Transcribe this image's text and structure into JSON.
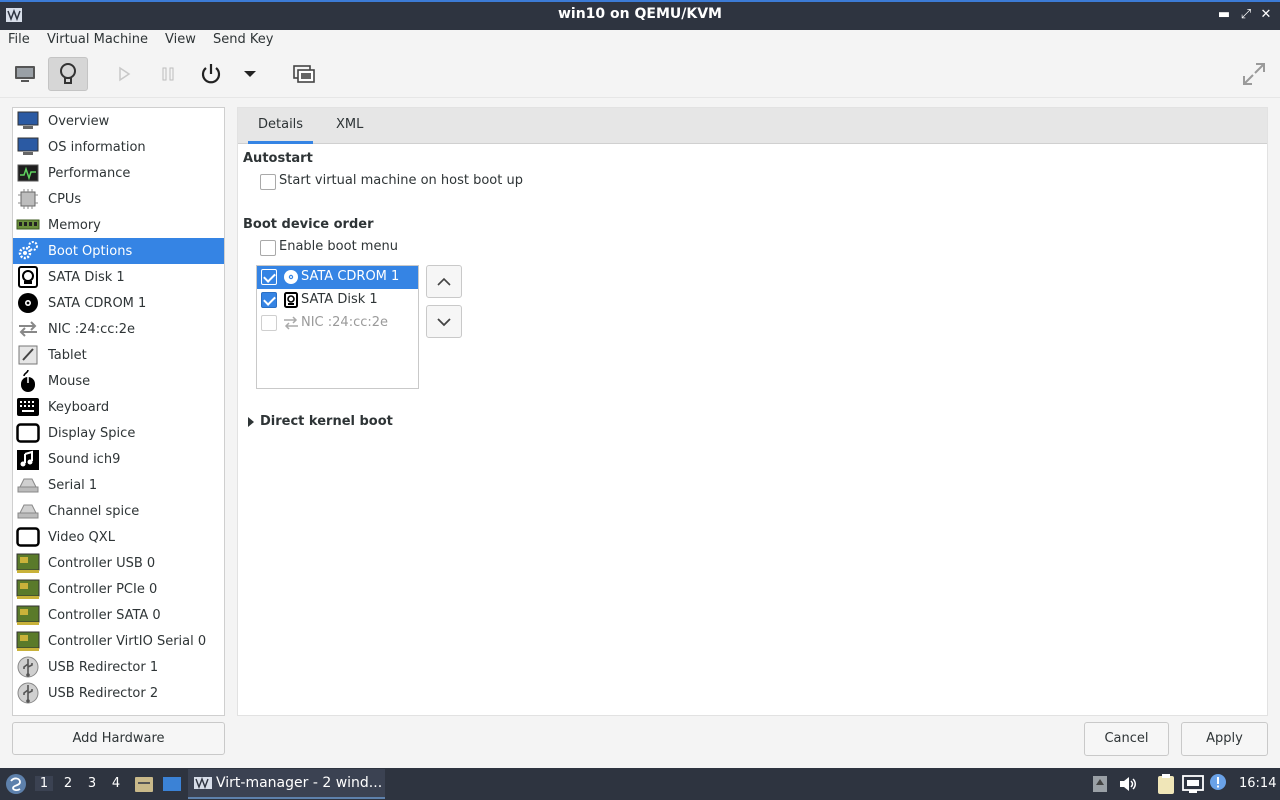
{
  "window": {
    "title": "win10 on QEMU/KVM"
  },
  "menubar": {
    "items": [
      "File",
      "Virtual Machine",
      "View",
      "Send Key"
    ]
  },
  "sidebar": {
    "items": [
      {
        "label": "Overview",
        "icon": "monitor-icon"
      },
      {
        "label": "OS information",
        "icon": "monitor-icon"
      },
      {
        "label": "Performance",
        "icon": "performance-chart-icon"
      },
      {
        "label": "CPUs",
        "icon": "cpu-chip-icon"
      },
      {
        "label": "Memory",
        "icon": "memory-module-icon"
      },
      {
        "label": "Boot Options",
        "icon": "gears-icon",
        "selected": true
      },
      {
        "label": "SATA Disk 1",
        "icon": "hard-disk-icon"
      },
      {
        "label": "SATA CDROM 1",
        "icon": "cdrom-icon"
      },
      {
        "label": "NIC :24:cc:2e",
        "icon": "network-arrows-icon"
      },
      {
        "label": "Tablet",
        "icon": "tablet-icon"
      },
      {
        "label": "Mouse",
        "icon": "mouse-icon"
      },
      {
        "label": "Keyboard",
        "icon": "keyboard-icon"
      },
      {
        "label": "Display Spice",
        "icon": "display-icon"
      },
      {
        "label": "Sound ich9",
        "icon": "sound-icon"
      },
      {
        "label": "Serial 1",
        "icon": "serial-port-icon"
      },
      {
        "label": "Channel spice",
        "icon": "channel-icon"
      },
      {
        "label": "Video QXL",
        "icon": "display-icon"
      },
      {
        "label": "Controller USB 0",
        "icon": "controller-card-icon"
      },
      {
        "label": "Controller PCIe 0",
        "icon": "controller-card-icon"
      },
      {
        "label": "Controller SATA 0",
        "icon": "controller-card-icon"
      },
      {
        "label": "Controller VirtIO Serial 0",
        "icon": "controller-card-icon"
      },
      {
        "label": "USB Redirector 1",
        "icon": "usb-icon"
      },
      {
        "label": "USB Redirector 2",
        "icon": "usb-icon"
      }
    ],
    "add_hardware": "Add Hardware"
  },
  "tabs": [
    "Details",
    "XML"
  ],
  "details": {
    "autostart_heading": "Autostart",
    "autostart_label": "Start virtual machine on host boot up",
    "autostart_checked": false,
    "boot_order_heading": "Boot device order",
    "enable_boot_menu": "Enable boot menu",
    "enable_boot_menu_checked": false,
    "boot_devices": [
      {
        "label": "SATA CDROM 1",
        "checked": true,
        "selected": true,
        "icon": "cdrom-icon"
      },
      {
        "label": "SATA Disk 1",
        "checked": true,
        "selected": false,
        "icon": "hard-disk-icon"
      },
      {
        "label": "NIC :24:cc:2e",
        "checked": false,
        "selected": false,
        "icon": "network-arrows-icon"
      }
    ],
    "direct_kernel_boot": "Direct kernel boot"
  },
  "buttons": {
    "cancel": "Cancel",
    "apply": "Apply"
  },
  "taskbar": {
    "workspaces": [
      "1",
      "2",
      "3",
      "4"
    ],
    "task_label": "Virt-manager - 2 wind...",
    "clock": "16:14"
  },
  "colors": {
    "accent": "#3584e4",
    "titlebar": "#2e3440"
  }
}
